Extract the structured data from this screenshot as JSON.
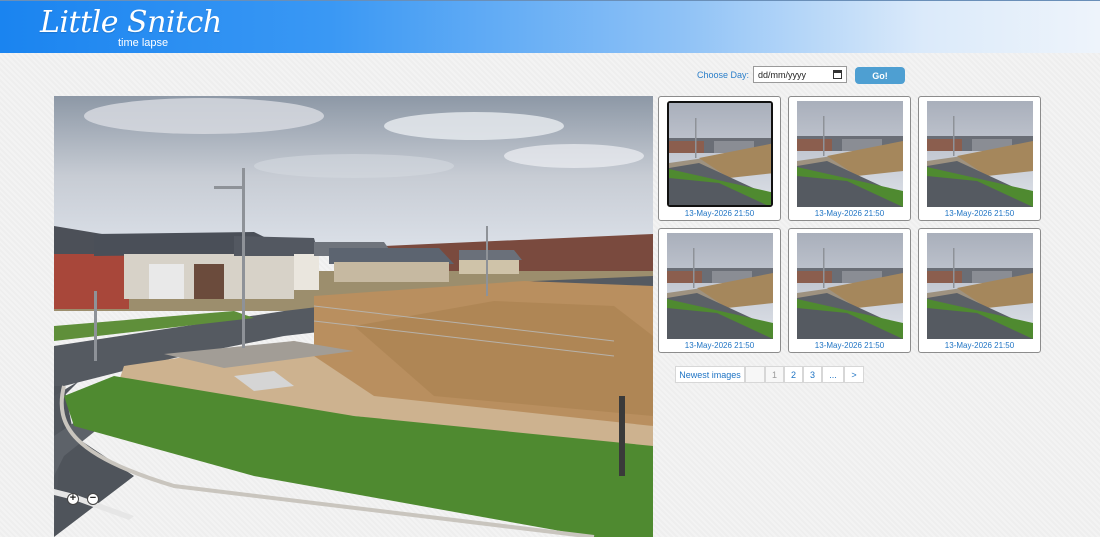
{
  "header": {
    "logo_title": "Little Snitch",
    "logo_subtitle": "time lapse"
  },
  "toolbar": {
    "choose_day_label": "Choose Day:",
    "date_placeholder": "dd/mm/yyyy",
    "go_label": "Go!"
  },
  "viewer": {
    "zoom_in_label": "+",
    "zoom_out_label": "−"
  },
  "thumbnails": [
    {
      "caption": "13-May-2026 21:50",
      "selected": true
    },
    {
      "caption": "13-May-2026 21:50",
      "selected": false
    },
    {
      "caption": "13-May-2026 21:50",
      "selected": false
    },
    {
      "caption": "13-May-2026 21:50",
      "selected": false
    },
    {
      "caption": "13-May-2026 21:50",
      "selected": false
    },
    {
      "caption": "13-May-2026 21:50",
      "selected": false
    }
  ],
  "pagination": {
    "newest_label": "Newest images",
    "pages": [
      "1",
      "2",
      "3",
      "...",
      ">"
    ]
  },
  "colors": {
    "accent": "#4e9fd2",
    "link": "#1f74c4"
  }
}
